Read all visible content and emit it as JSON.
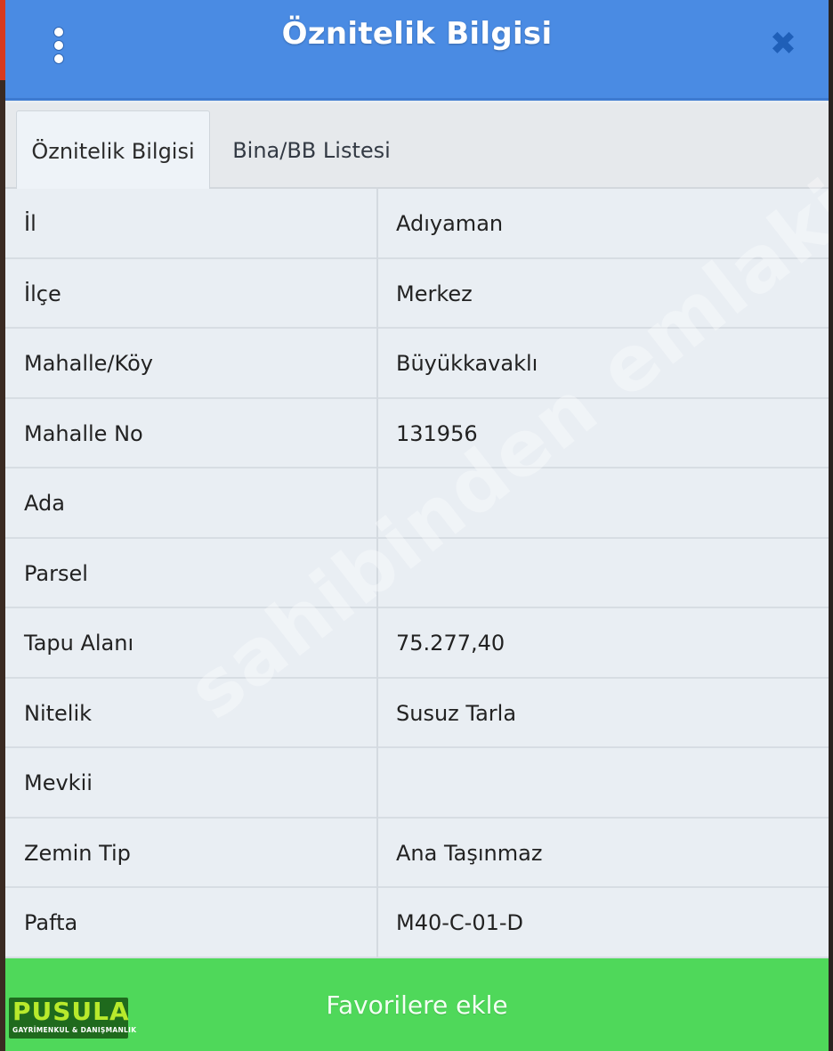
{
  "header": {
    "title": "Öznitelik Bilgisi",
    "menu_icon": "kebab-menu-icon",
    "close_icon": "close-icon",
    "background": "#4a8be3"
  },
  "tabs": [
    {
      "label": "Öznitelik Bilgisi",
      "active": true
    },
    {
      "label": "Bina/BB Listesi",
      "active": false
    }
  ],
  "rows": [
    {
      "label": "İl",
      "value": "Adıyaman"
    },
    {
      "label": "İlçe",
      "value": "Merkez"
    },
    {
      "label": "Mahalle/Köy",
      "value": "Büyükkavaklı"
    },
    {
      "label": "Mahalle No",
      "value": "131956"
    },
    {
      "label": "Ada",
      "value": ""
    },
    {
      "label": "Parsel",
      "value": ""
    },
    {
      "label": "Tapu Alanı",
      "value": "75.277,40"
    },
    {
      "label": "Nitelik",
      "value": "Susuz Tarla"
    },
    {
      "label": "Mevkii",
      "value": ""
    },
    {
      "label": "Zemin Tip",
      "value": "Ana Taşınmaz"
    },
    {
      "label": "Pafta",
      "value": "M40-C-01-D"
    }
  ],
  "watermark": "sahibinden emlakjet.com",
  "footer": {
    "button_label": "Favorilere ekle",
    "background": "#4fd85a"
  },
  "logo": {
    "word": "PUSULA",
    "subtitle": "GAYRİMENKUL & DANIŞMANLIK"
  }
}
